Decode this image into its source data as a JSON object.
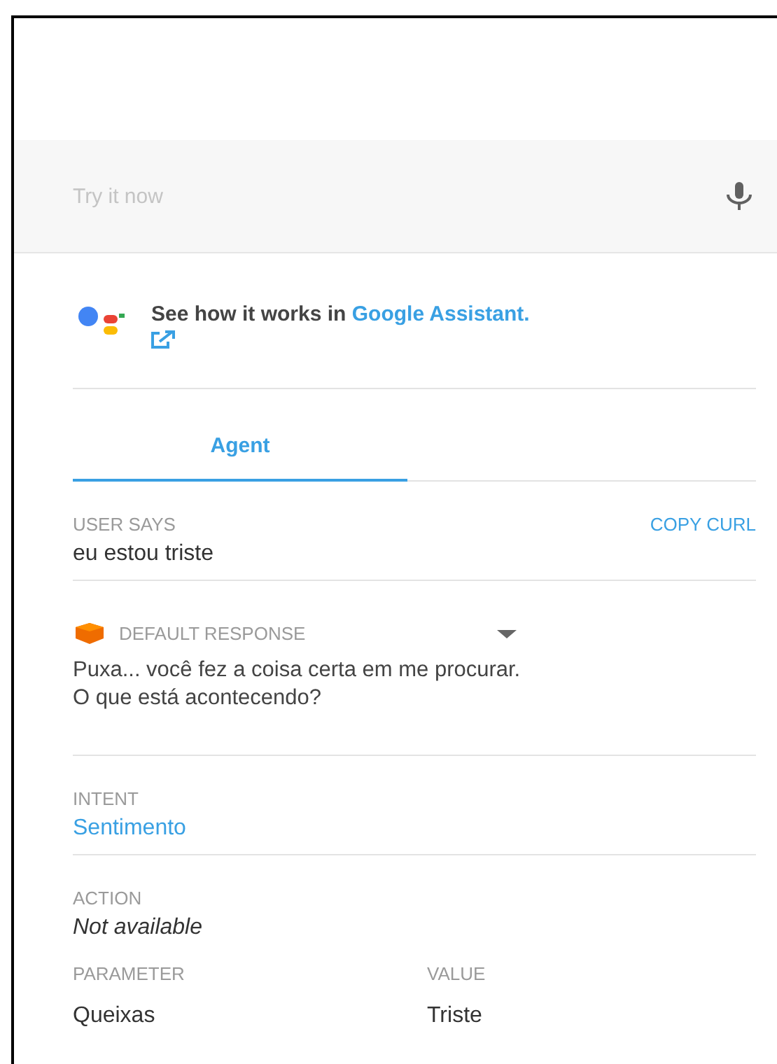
{
  "query_field": {
    "placeholder": "Try it now"
  },
  "assistant_promo": {
    "text": "See how it works in ",
    "link": "Google Assistant."
  },
  "tabs": [
    {
      "label": "Agent",
      "selected": true
    }
  ],
  "user_says": {
    "label": "USER SAYS",
    "action": "COPY CURL",
    "value": "eu estou triste"
  },
  "response": {
    "label": "DEFAULT RESPONSE",
    "text": "Puxa... você fez a coisa certa em me procurar.\nO que está acontecendo?"
  },
  "intent": {
    "label": "INTENT",
    "value": "Sentimento"
  },
  "action": {
    "label": "ACTION",
    "value": "Not available"
  },
  "parameters": {
    "columns": [
      "PARAMETER",
      "VALUE"
    ],
    "rows": [
      [
        "Queixas",
        "Triste"
      ]
    ]
  }
}
